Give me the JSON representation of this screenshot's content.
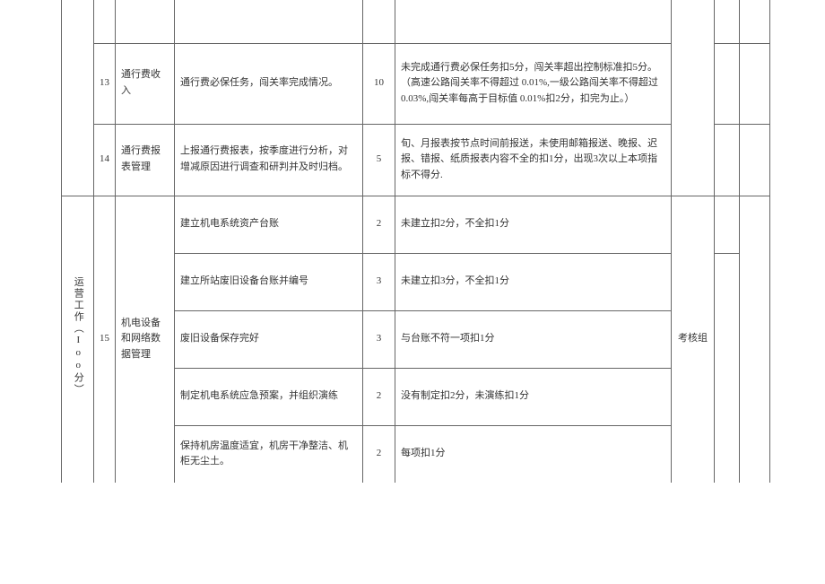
{
  "category": "运营工作（Ioo分）",
  "rows_upper": [
    {
      "num": "13",
      "item": "通行费收入",
      "content": "通行费必保任务，闯关率完成情况。",
      "score": "10",
      "criteria": "未完成通行费必保任务扣5分，闯关率超出控制标准扣5分。（高速公路闯关率不得超过 0.01%,一级公路闯关率不得超过 0.03%,闯关率每高于目标值 0.01%扣2分，扣完为止。）"
    },
    {
      "num": "14",
      "item": "通行费报表管理",
      "content": "上报通行费报表，按季度进行分析，对增减原因进行调查和研判并及时归档。",
      "score": "5",
      "criteria": "旬、月报表按节点时间前报送，未使用邮箱报送、晚报、迟报、错报、纸质报表内容不全的扣1分，出现3次以上本项指标不得分."
    }
  ],
  "row15": {
    "num": "15",
    "item": "机电设备和网络数据管理",
    "group": "考核组",
    "subrows": [
      {
        "content": "建立机电系统资产台账",
        "score": "2",
        "criteria": "未建立扣2分，不全扣1分"
      },
      {
        "content": "建立所站废旧设备台账并编号",
        "score": "3",
        "criteria": "未建立扣3分，不全扣1分"
      },
      {
        "content": "废旧设备保存完好",
        "score": "3",
        "criteria": "与台账不符一项扣1分"
      },
      {
        "content": "制定机电系统应急预案，并组织演练",
        "score": "2",
        "criteria": "没有制定扣2分，未演练扣1分"
      },
      {
        "content": "保持机房温度适宜，机房干净整洁、机柜无尘土。",
        "score": "2",
        "criteria": "每项扣1分"
      }
    ]
  }
}
